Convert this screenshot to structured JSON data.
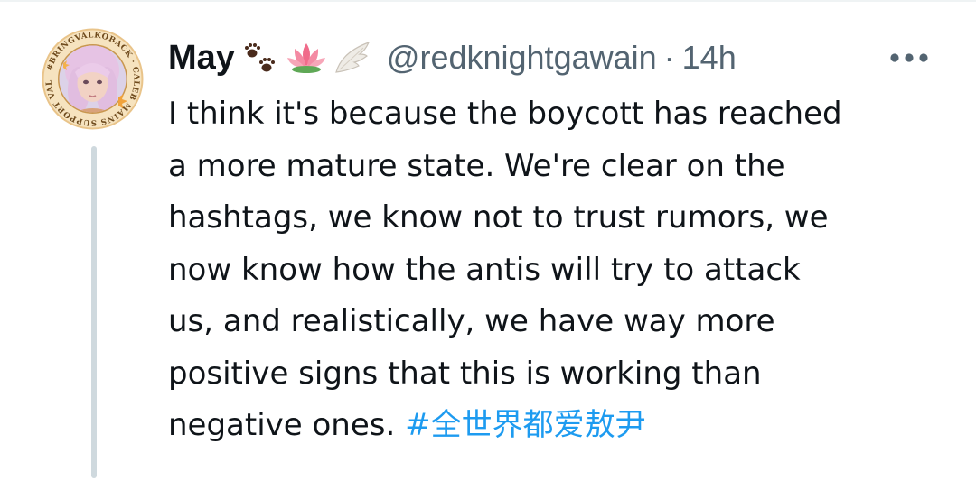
{
  "tweet": {
    "author": {
      "display_name": "May",
      "handle": "@redknightgawain",
      "emoji": [
        "paw-prints-emoji",
        "lotus-emoji",
        "wing-emoji"
      ],
      "avatar": {
        "badge_text": "#BRINGVALKOBACK · CALEB MAINS SUPPORT VALKO"
      }
    },
    "separator": "·",
    "timestamp": "14h",
    "body_lines": [
      "I think it's because the boycott has reached",
      "a more mature state. We're clear on the",
      "hashtags, we know not to trust rumors, we",
      "now know how the antis will try to attack",
      "us, and realistically, we have way more",
      "positive signs that this is working than"
    ],
    "last_line_text": "negative ones. ",
    "hashtag": "#全世界都爱敖尹",
    "more_icon": "more-horizontal-icon"
  },
  "colors": {
    "text_primary": "#0f1419",
    "text_secondary": "#536471",
    "link": "#1d9bf0",
    "thread_line": "#cfd9de"
  }
}
